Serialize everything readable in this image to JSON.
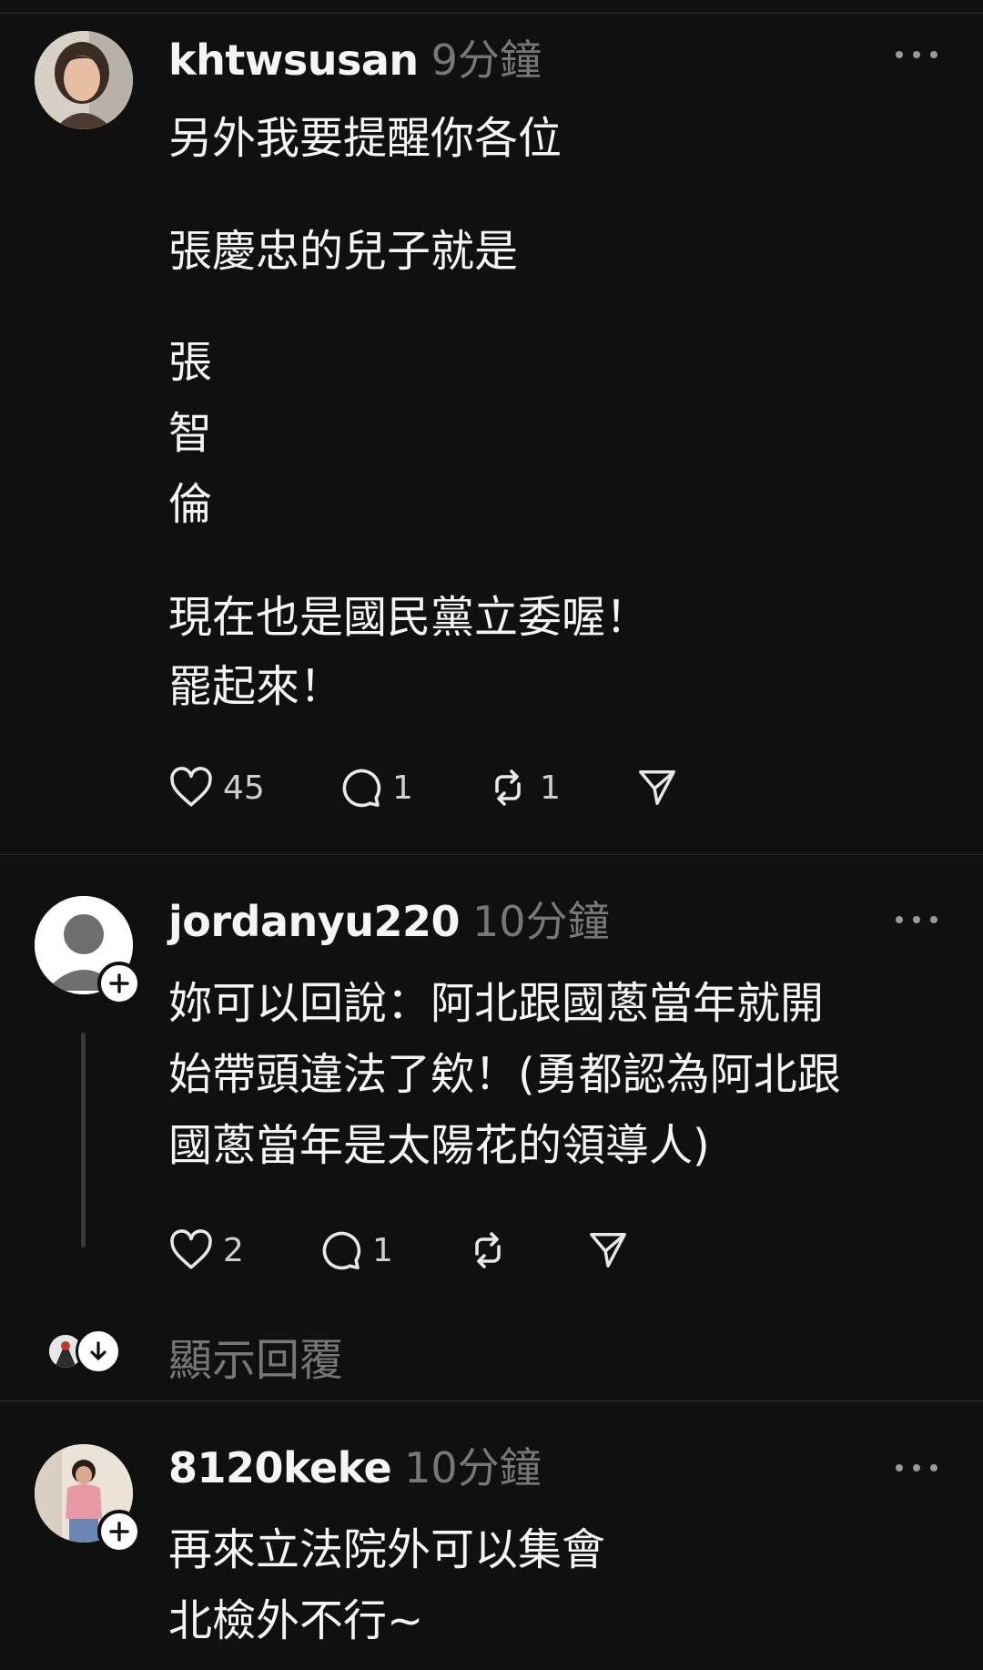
{
  "posts": [
    {
      "username": "khtwsusan",
      "timestamp": "9分鐘",
      "text_lines": [
        "另外我要提醒你各位",
        "張慶忠的兒子就是",
        "張",
        "智",
        "倫",
        "現在也是國民黨立委喔！",
        "罷起來！"
      ],
      "likes": "45",
      "replies": "1",
      "reposts": "1"
    },
    {
      "username": "jordanyu220",
      "timestamp": "10分鐘",
      "text_lines": [
        "妳可以回說：阿北跟國蔥當年就開",
        "始帶頭違法了欸！(勇都認為阿北跟",
        "國蔥當年是太陽花的領導人)"
      ],
      "likes": "2",
      "replies": "1",
      "show_replies": "顯示回覆"
    },
    {
      "username": "8120keke",
      "timestamp": "10分鐘",
      "text_lines": [
        "再來立法院外可以集會",
        "北檢外不行~"
      ]
    }
  ],
  "icons": {
    "like": "heart-icon",
    "reply": "comment-icon",
    "repost": "repost-icon",
    "share": "send-icon",
    "more": "more-icon",
    "follow": "plus-icon",
    "expand": "arrow-down-icon"
  },
  "colors": {
    "background": "#101010",
    "text": "#f3f5f7",
    "muted": "#777777"
  }
}
